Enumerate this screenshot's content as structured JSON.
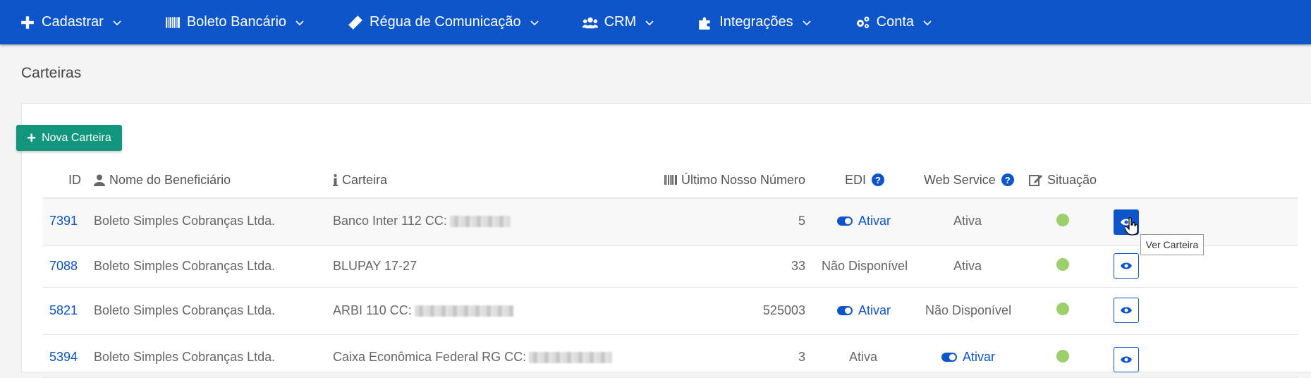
{
  "nav": {
    "items": [
      {
        "label": "Cadastrar",
        "icon": "plus-icon"
      },
      {
        "label": "Boleto Bancário",
        "icon": "barcode-icon"
      },
      {
        "label": "Régua de Comunicação",
        "icon": "ruler-icon"
      },
      {
        "label": "CRM",
        "icon": "users-icon"
      },
      {
        "label": "Integrações",
        "icon": "puzzle-icon"
      },
      {
        "label": "Conta",
        "icon": "gears-icon"
      }
    ]
  },
  "page": {
    "title": "Carteiras",
    "new_button": "Nova Carteira"
  },
  "table": {
    "headers": {
      "id": "ID",
      "beneficiario": "Nome do Beneficiário",
      "carteira": "Carteira",
      "ultimo": "Último Nosso Número",
      "edi": "EDI",
      "ws": "Web Service",
      "situacao": "Situação"
    },
    "rows": [
      {
        "id": "7391",
        "beneficiario": "Boleto Simples Cobranças Ltda.",
        "carteira": "Banco Inter 112 CC:",
        "ultimo": "5",
        "edi": "Ativar",
        "ws": "Ativa"
      },
      {
        "id": "7088",
        "beneficiario": "Boleto Simples Cobranças Ltda.",
        "carteira": "BLUPAY 17-27",
        "ultimo": "33",
        "edi": "Não Disponível",
        "ws": "Ativa"
      },
      {
        "id": "5821",
        "beneficiario": "Boleto Simples Cobranças Ltda.",
        "carteira": "ARBI 110 CC:",
        "ultimo": "525003",
        "edi": "Ativar",
        "ws": "Não Disponível"
      },
      {
        "id": "5394",
        "beneficiario": "Boleto Simples Cobranças Ltda.",
        "carteira": "Caixa Econômica Federal RG CC:",
        "ultimo": "3",
        "edi": "Ativa",
        "ws": "Ativar"
      }
    ]
  },
  "tooltip": "Ver Carteira",
  "colors": {
    "primary": "#0d55c9",
    "success": "#12967d",
    "status_ok": "#9bd06d"
  }
}
